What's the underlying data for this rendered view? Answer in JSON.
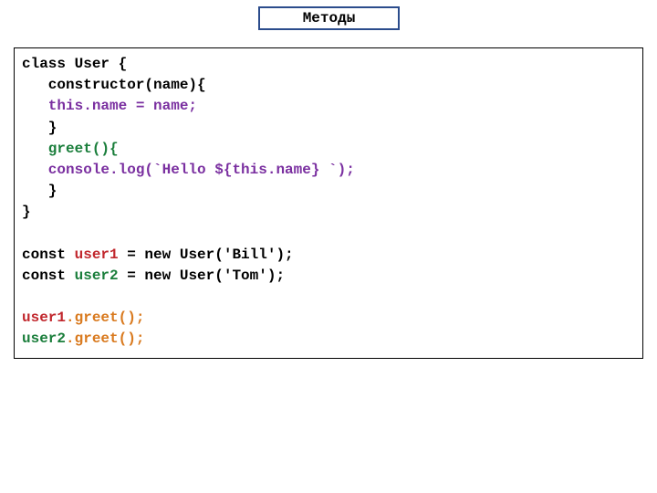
{
  "title": "Методы",
  "code": {
    "lines": [
      [
        {
          "t": "class User {",
          "cls": ""
        }
      ],
      [
        {
          "t": "   constructor(name){",
          "cls": ""
        }
      ],
      [
        {
          "t": "   this.name = name;",
          "cls": "c-purple"
        }
      ],
      [
        {
          "t": "   }",
          "cls": ""
        }
      ],
      [
        {
          "t": "   greet(){",
          "cls": "c-green"
        }
      ],
      [
        {
          "t": "   console.log(`Hello ${this.name} `);",
          "cls": "c-purple"
        }
      ],
      [
        {
          "t": "   }",
          "cls": ""
        }
      ],
      [
        {
          "t": "}",
          "cls": ""
        }
      ],
      [
        {
          "t": " ",
          "cls": ""
        }
      ],
      [
        {
          "t": "const ",
          "cls": ""
        },
        {
          "t": "user1",
          "cls": "c-red"
        },
        {
          "t": " = new User('Bill');",
          "cls": ""
        }
      ],
      [
        {
          "t": "const ",
          "cls": ""
        },
        {
          "t": "user2",
          "cls": "c-green"
        },
        {
          "t": " = new User('Tom');",
          "cls": ""
        }
      ],
      [
        {
          "t": " ",
          "cls": ""
        }
      ],
      [
        {
          "t": "user1",
          "cls": "c-red"
        },
        {
          "t": ".greet();",
          "cls": "c-orange"
        }
      ],
      [
        {
          "t": "user2",
          "cls": "c-green"
        },
        {
          "t": ".greet();",
          "cls": "c-orange"
        }
      ]
    ]
  }
}
